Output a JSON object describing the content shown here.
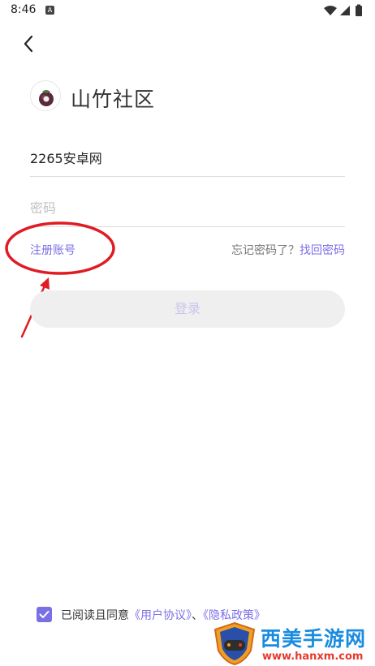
{
  "status_bar": {
    "time": "8:46",
    "notification_icon": "A"
  },
  "header": {
    "back_icon": "chevron-left-icon"
  },
  "app": {
    "name": "山竹社区",
    "logo_icon": "mangosteen-logo"
  },
  "form": {
    "username_value": "2265安卓网",
    "password_placeholder": "密码"
  },
  "links": {
    "register": "注册账号",
    "forgot_text": "忘记密码了？",
    "recover": "找回密码"
  },
  "login_button": "登录",
  "agreement": {
    "checked": true,
    "prefix": "已阅读且同意",
    "user_agreement": "《用户协议》",
    "separator": "、",
    "privacy_policy": "《隐私政策》"
  },
  "watermark": {
    "name": "西美手游网",
    "url": "www.hanxm.com"
  },
  "colors": {
    "accent": "#7b6fe6",
    "annotation": "#e01b24",
    "button_bg": "#efefef"
  }
}
